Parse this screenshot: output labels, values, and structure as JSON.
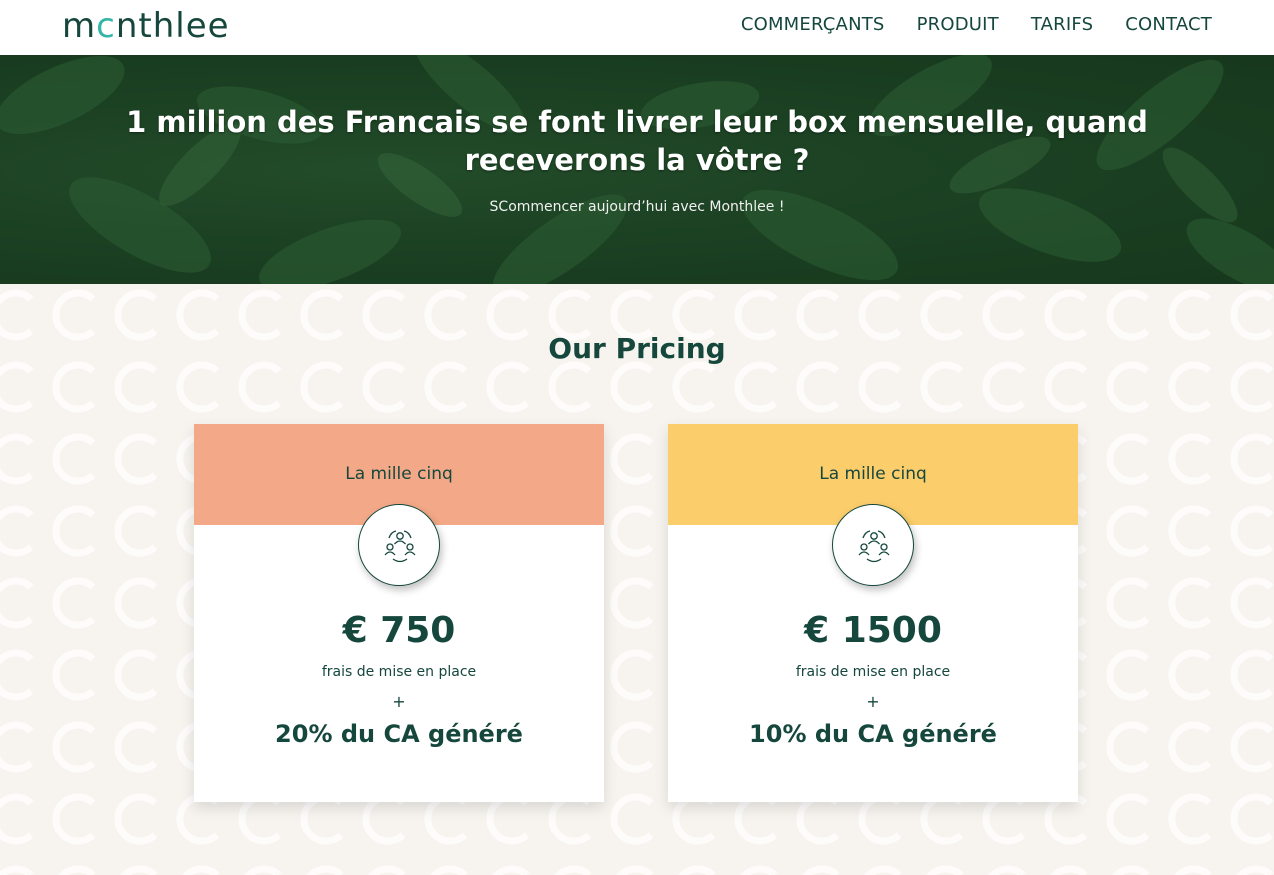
{
  "header": {
    "logo_pre": "m",
    "logo_accent": "c",
    "logo_post": "nthlee",
    "nav": [
      "COMMERÇANTS",
      "PRODUIT",
      "TARIFS",
      "CONTACT"
    ]
  },
  "hero": {
    "title": "1 million des Francais se font livrer leur box mensuelle, quand receverons la vôtre ?",
    "subtitle": "SCommencer aujourd’hui avec Monthlee !"
  },
  "pricing": {
    "title": "Our Pricing",
    "plans": [
      {
        "name": "La mille cinq",
        "price": "€ 750",
        "setup": "frais de mise en place",
        "plus": "+",
        "commission": "20% du CA généré",
        "header_color": "#f3a987",
        "icon": "people-group-icon"
      },
      {
        "name": "La mille cinq",
        "price": "€ 1500",
        "setup": "frais de mise en place",
        "plus": "+",
        "commission": "10% du CA généré",
        "header_color": "#fbcd6b",
        "icon": "people-group-icon"
      }
    ]
  },
  "colors": {
    "primary": "#15473d",
    "accent": "#32b7a6",
    "background": "#f7f4ef"
  }
}
